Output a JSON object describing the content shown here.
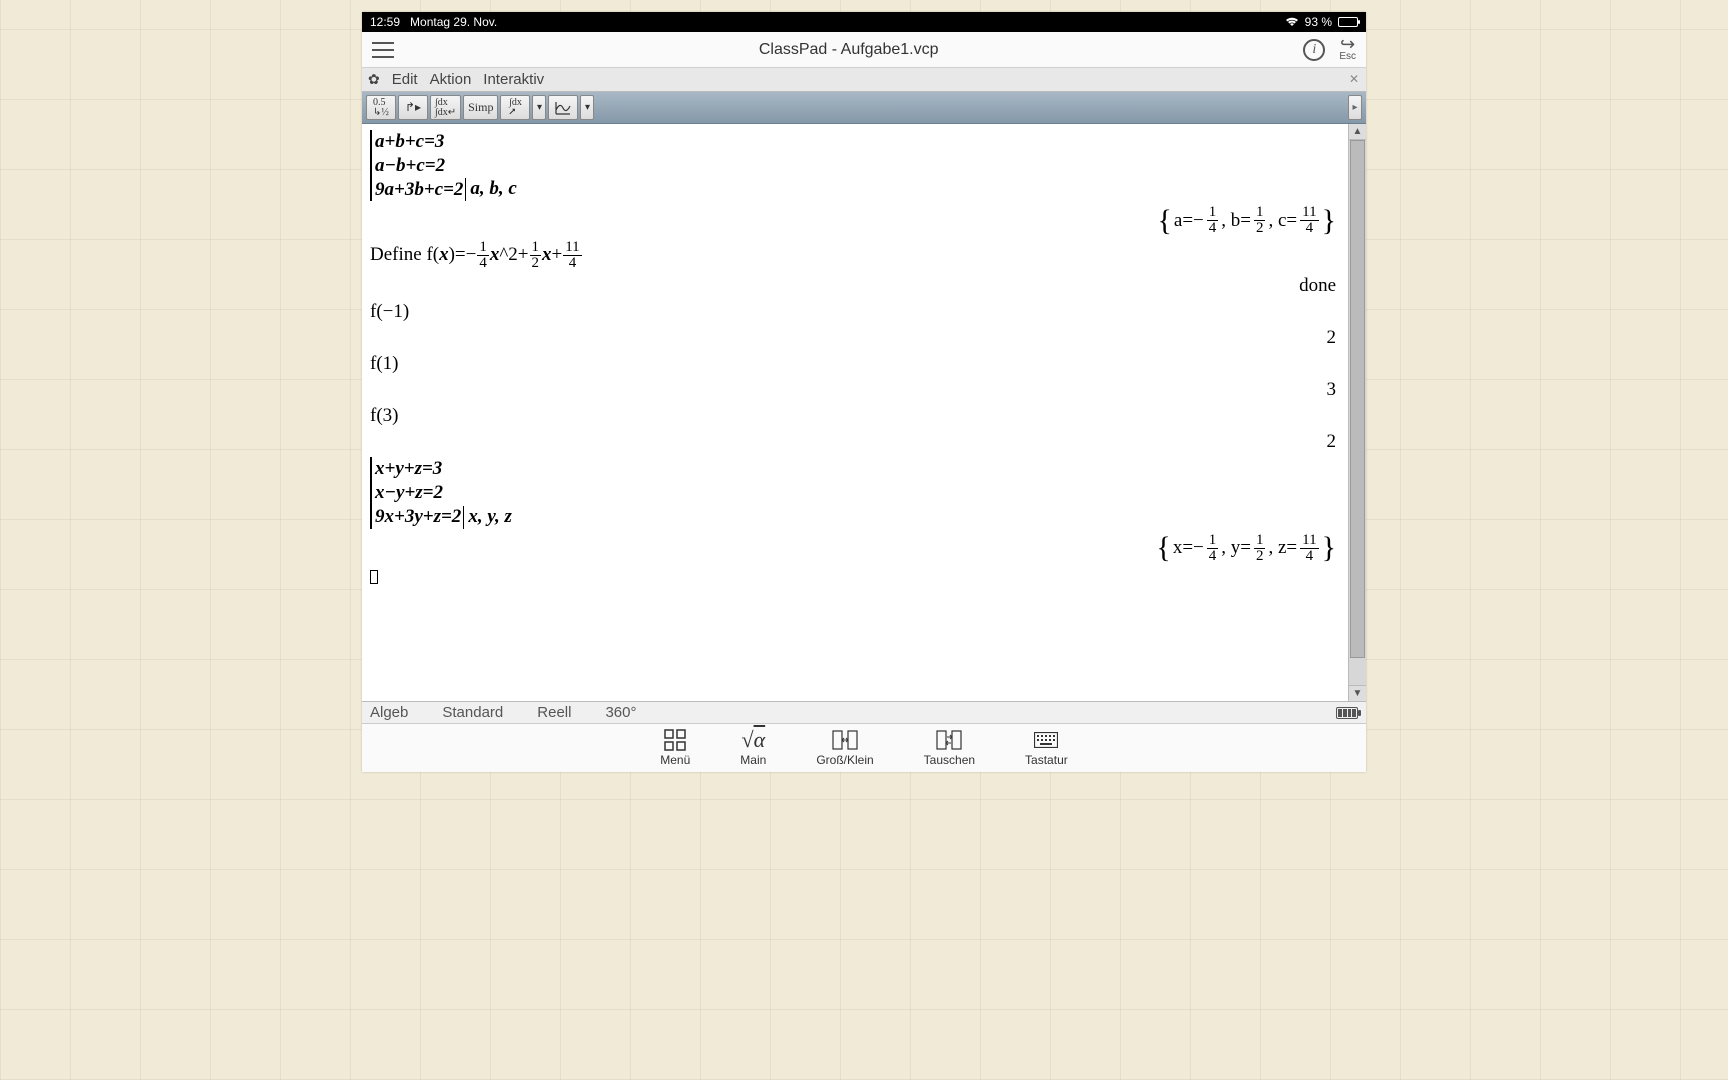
{
  "status": {
    "time": "12:59",
    "date": "Montag 29. Nov.",
    "battery_pct": "93 %"
  },
  "app": {
    "title": "ClassPad - Aufgabe1.vcp",
    "esc_label": "Esc"
  },
  "menu": {
    "edit": "Edit",
    "aktion": "Aktion",
    "interaktiv": "Interaktiv"
  },
  "toolbar": {
    "btn1": "0.5↳1½",
    "btn2": "↱▶",
    "btn3": "∫dx↵",
    "simp": "Simp",
    "btn5": "∫dx⬈"
  },
  "cas": {
    "sys1": {
      "e1": "a+b+c=3",
      "e2": "a−b+c=2",
      "e3": "9a+3b+c=2",
      "vars": "a, b, c"
    },
    "sol1": {
      "a_eq": "a=−",
      "a_num": "1",
      "a_den": "4",
      "b_eq": ", b=",
      "b_num": "1",
      "b_den": "2",
      "c_eq": ", c=",
      "c_num": "11",
      "c_den": "4"
    },
    "define_pre": "Define  f(",
    "define_x": "x",
    "define_mid1": ")=−",
    "def_f1n": "1",
    "def_f1d": "4",
    "define_xsq_pre": "",
    "define_x2": "x",
    "define_xsq_post": "^2+",
    "def_f2n": "1",
    "def_f2d": "2",
    "define_x3": "x",
    "define_plus": "+",
    "def_f3n": "11",
    "def_f3d": "4",
    "done": "done",
    "fneg1": "f(−1)",
    "rneg1": "2",
    "f1": "f(1)",
    "r1": "3",
    "f3": "f(3)",
    "r3": "2",
    "sys2": {
      "e1": "x+y+z=3",
      "e2": "x−y+z=2",
      "e3": "9x+3y+z=2",
      "vars": "x, y, z"
    },
    "sol2": {
      "x_eq": "x=−",
      "x_num": "1",
      "x_den": "4",
      "y_eq": ", y=",
      "y_num": "1",
      "y_den": "2",
      "z_eq": ", z=",
      "z_num": "11",
      "z_den": "4"
    }
  },
  "status2": {
    "mode": "Algeb",
    "fmt": "Standard",
    "num": "Reell",
    "ang": "360°"
  },
  "dock": {
    "menu": "Menü",
    "main": "Main",
    "gross": "Groß/Klein",
    "tauschen": "Tauschen",
    "tastatur": "Tastatur"
  }
}
